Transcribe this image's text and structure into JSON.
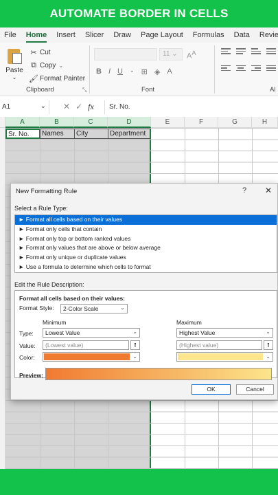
{
  "banner": {
    "title": "AUTOMATE BORDER IN CELLS"
  },
  "menu": {
    "tabs": [
      "File",
      "Home",
      "Insert",
      "Slicer",
      "Draw",
      "Page Layout",
      "Formulas",
      "Data",
      "Review"
    ],
    "active": "Home"
  },
  "ribbon": {
    "paste_label": "Paste",
    "cut_label": "Cut",
    "copy_label": "Copy",
    "format_painter_label": "Format Painter",
    "clipboard_group": "Clipboard",
    "font_group": "Font",
    "alignment_group_partial": "Al",
    "font_size": "11"
  },
  "formula_bar": {
    "name_box": "A1",
    "content": "Sr. No."
  },
  "sheet": {
    "columns": [
      "A",
      "B",
      "C",
      "D",
      "E",
      "F",
      "G",
      "H"
    ],
    "header_cells": [
      "Sr. No.",
      "Names",
      "City",
      "Department"
    ]
  },
  "dialog": {
    "title": "New Formatting Rule",
    "help": "?",
    "close": "✕",
    "select_rule_label": "Select a Rule Type:",
    "rule_types": [
      "► Format all cells based on their values",
      "► Format only cells that contain",
      "► Format only top or bottom ranked values",
      "► Format only values that are above or below average",
      "► Format only unique or duplicate values",
      "► Use a formula to determine which cells to format"
    ],
    "selected_rule_index": 0,
    "edit_label": "Edit the Rule Description:",
    "desc_heading": "Format all cells based on their values:",
    "format_style_label": "Format Style:",
    "format_style_value": "2-Color Scale",
    "minimum_label": "Minimum",
    "maximum_label": "Maximum",
    "type_label": "Type:",
    "value_label": "Value:",
    "color_label": "Color:",
    "min_type": "Lowest Value",
    "max_type": "Highest Value",
    "min_value_placeholder": "(Lowest value)",
    "max_value_placeholder": "(Highest value)",
    "min_color": "#f07a30",
    "max_color": "#fce58c",
    "preview_label": "Preview:",
    "ok_label": "OK",
    "cancel_label": "Cancel"
  },
  "colors": {
    "accent_green": "#12c24a",
    "excel_green": "#1e7a40",
    "selection_blue": "#0a6fd6"
  }
}
